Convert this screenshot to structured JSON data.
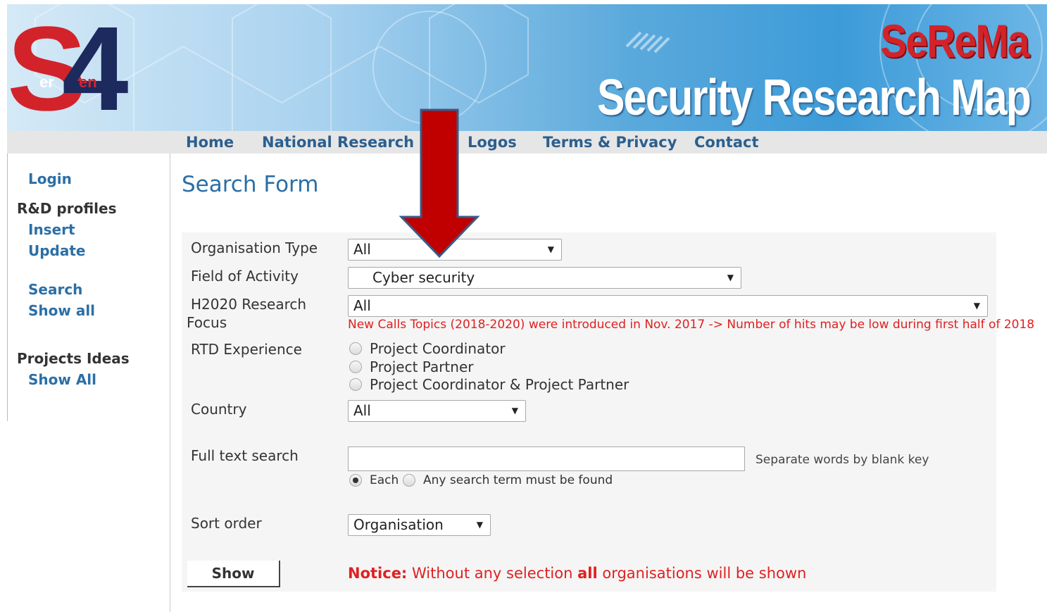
{
  "banner": {
    "logo_letter_s": "S",
    "logo_digit": "4",
    "logo_sub_left": "er",
    "logo_sub_right": "en",
    "brand_short": "SeReMa",
    "brand_title": "Security Research Map",
    "colors": {
      "brand_red": "#d2232a",
      "logo_blue": "#1c2a5e",
      "banner_blue": "#3d9bd8"
    }
  },
  "nav": {
    "items": [
      {
        "label": "Home"
      },
      {
        "label": "National Research Map"
      },
      {
        "label": "Logos"
      },
      {
        "label": "Terms & Privacy"
      },
      {
        "label": "Contact"
      }
    ]
  },
  "sidebar": {
    "login": "Login",
    "rd_profiles_heading": "R&D profiles",
    "insert": "Insert",
    "update": "Update",
    "search": "Search",
    "show_all": "Show all",
    "projects_heading": "Projects Ideas",
    "projects_show_all": "Show All"
  },
  "main": {
    "title": "Search Form",
    "fields": {
      "org_type": {
        "label": "Organisation Type",
        "value": "All"
      },
      "activity": {
        "label": "Field of Activity",
        "value": "Cyber security"
      },
      "h2020": {
        "label_line1": "H2020 Research",
        "label_line2": "Focus",
        "value": "All",
        "hint": "New Calls Topics (2018-2020) were introduced in Nov. 2017 -> Number of hits may be low during first half of 2018"
      },
      "rtd": {
        "label": "RTD Experience",
        "options": [
          "Project Coordinator",
          "Project Partner",
          "Project Coordinator & Project Partner"
        ]
      },
      "country": {
        "label": "Country",
        "value": "All"
      },
      "fulltext": {
        "label": "Full text search",
        "value": "",
        "hint": "Separate words by blank key",
        "opt_each": "Each",
        "opt_any": "Any search term must be found",
        "selected": "Each"
      },
      "sort": {
        "label": "Sort order",
        "value": "Organisation"
      }
    },
    "show_button": "Show",
    "notice_prefix": "Notice:",
    "notice_text_1": " Without any selection ",
    "notice_bold": "all",
    "notice_text_2": " organisations will be shown"
  },
  "overlay": {
    "icon": "red-down-arrow-icon",
    "color": "#c00000"
  }
}
